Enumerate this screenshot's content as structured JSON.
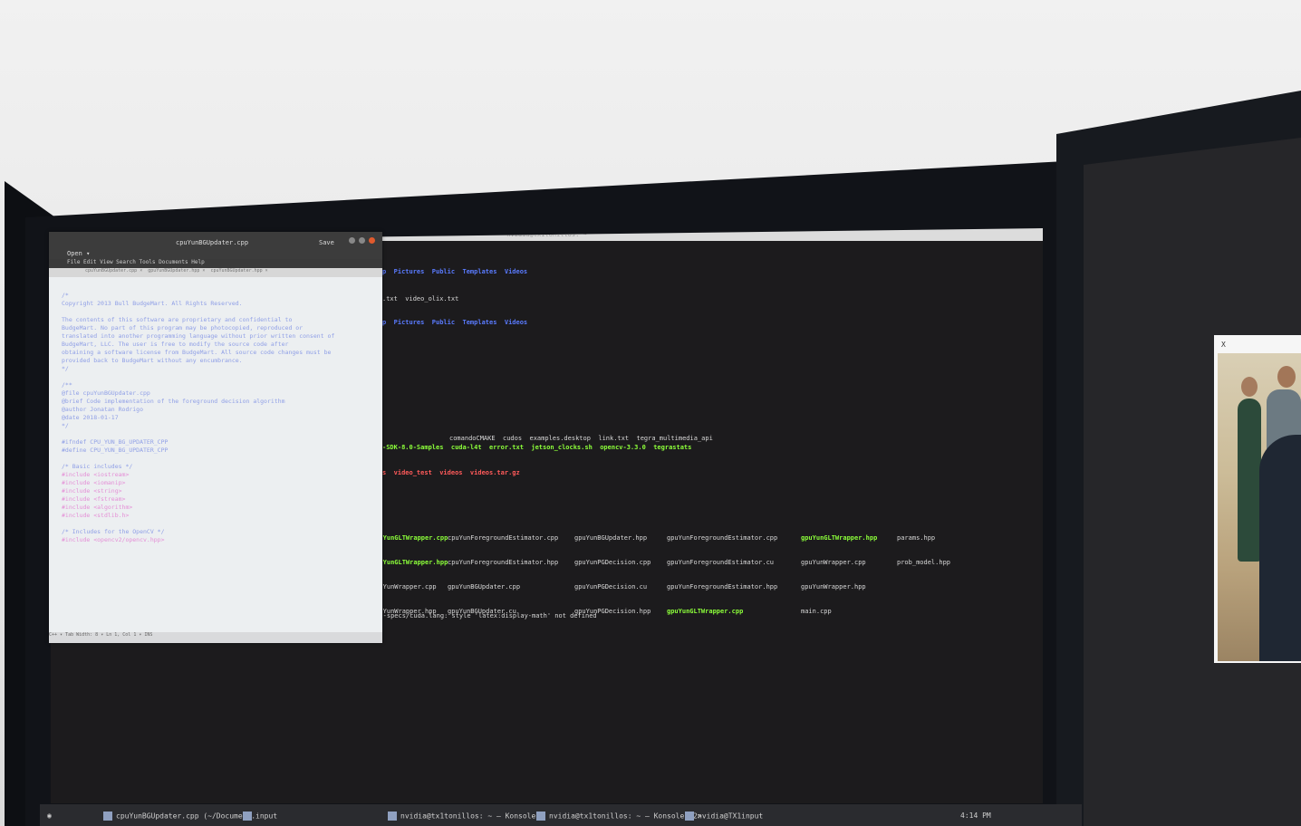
{
  "terminal": {
    "title": "nvidia@tx1tonillos: ~",
    "lines": [
      {
        "text": "p  Pictures  Public  Templates  Videos",
        "cls": "blue"
      },
      {
        "text": ".txt  video_olix.txt",
        "cls": ""
      },
      {
        "text": "p  Pictures  Public  Templates  Videos",
        "cls": "blue"
      },
      {
        "text": "comandoCMAKE  cudos  examples.desktop  link.txt  tegra_multimedia_api",
        "cls": "mix1"
      },
      {
        "text": "-SDK-8.0-Samples  cuda-l4t  error.txt  jetson_clocks.sh  opencv-3.3.0  tegrastats",
        "cls": "mix2"
      },
      {
        "text": "s  video_test  videos  videos.tar.gz",
        "cls": "mix3"
      },
      {
        "text": "apt-specs/cuda.lang: style 'latex:display-math' not defined",
        "cls": ""
      }
    ],
    "files_col1": [
      "gpuYunGLTWrapper.cpp",
      "gpuYunGLTWrapper.hpp",
      "gpuYunWrapper.cpp",
      "gpuYunWrapper.hpp"
    ],
    "files_col2": [
      "cpuYunForegroundEstimator.cpp",
      "cpuYunForegroundEstimator.hpp",
      "gpuYunBGUpdater.cpp",
      "gpuYunBGUpdater.cu"
    ],
    "files_col3": [
      "gpuYunBGUpdater.hpp",
      "gpuYunPGDecision.cpp",
      "gpuYunPGDecision.cu",
      "gpuYunPGDecision.hpp"
    ],
    "files_col4": [
      "gpuYunForegroundEstimator.cpp",
      "gpuYunForegroundEstimator.cu",
      "gpuYunForegroundEstimator.hpp",
      "gpuYunGLTWrapper.cpp"
    ],
    "files_col5": [
      "gpuYunGLTWrapper.hpp",
      "gpuYunWrapper.cpp",
      "gpuYunWrapper.hpp",
      "main.cpp"
    ],
    "files_col6": [
      "params.hpp",
      "prob_model.hpp"
    ]
  },
  "editor": {
    "title": "cpuYunBGUpdater.cpp",
    "open_label": "Open ▾",
    "save_label": "Save",
    "menu": "File  Edit  View  Search  Tools  Documents  Help",
    "tabs": [
      "cpuYunBGUpdater.cpp ×",
      "gpuYunBGUpdater.hpp ×",
      "cpuYunBGUpdater.hpp ×"
    ],
    "code": [
      "/*",
      " Copyright 2013 Bull BudgeMart. All Rights Reserved.",
      "",
      " The contents of this software are proprietary and confidential to",
      " BudgeMart. No part of this program may be photocopied, reproduced or",
      " translated into another programming language without prior written consent of",
      " BudgeMart, LLC. The user is free to modify the source code after",
      " obtaining a software license from BudgeMart. All source code changes must be",
      " provided back to BudgeMart without any encumbrance.",
      "*/",
      "",
      "/**",
      " @file  cpuYunBGUpdater.cpp",
      " @brief  Code implementation of the foreground decision algorithm",
      " @author  Jonatan Rodrigo",
      " @date  2018-01-17",
      "*/",
      "",
      "#ifndef CPU_YUN_BG_UPDATER_CPP",
      "#define CPU_YUN_BG_UPDATER_CPP",
      "",
      "/* Basic includes */",
      "#include  <iostream>",
      "#include  <iomanip>",
      "#include  <string>",
      "#include  <fstream>",
      "#include  <algorithm>",
      "#include  <stdlib.h>",
      "",
      "/* Includes for the OpenCV */",
      "#include  <opencv2/opencv.hpp>"
    ],
    "status": "C++ ▾   Tab Width: 8 ▾   Ln 1, Col 1   ▾   INS"
  },
  "taskbar": {
    "items": [
      "cpuYunBGUpdater.cpp (~/Docume...",
      "input",
      "nvidia@tx1tonillos: ~ — Konsole",
      "nvidia@tx1tonillos: ~ — Konsole <2>",
      "nvidia@TX1input"
    ],
    "clock": "4:14 PM"
  },
  "photo_window": {
    "close_label": "X"
  }
}
